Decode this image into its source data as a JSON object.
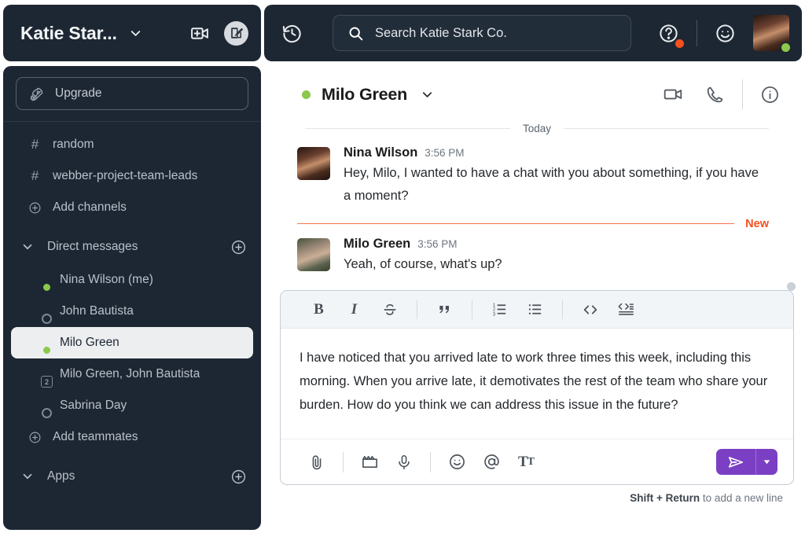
{
  "workspace": {
    "title": "Katie Star...",
    "chevron_icon": "chevron-down-icon",
    "new_call_icon": "new-video-call-icon",
    "compose_icon": "compose-message-icon"
  },
  "sidebar": {
    "upgrade": {
      "label": "Upgrade",
      "icon": "rocket-icon"
    },
    "channels": [
      {
        "label": "random",
        "icon": "hash-icon",
        "type": "channel"
      },
      {
        "label": "webber-project-team-leads",
        "icon": "hash-icon",
        "type": "channel"
      },
      {
        "label": "Add channels",
        "icon": "plus-circle-icon",
        "type": "action"
      }
    ],
    "dm_section": {
      "label": "Direct messages",
      "collapse_icon": "chevron-down-icon",
      "add_icon": "plus-circle-icon"
    },
    "dms": [
      {
        "label": "Nina Wilson (me)",
        "status": "online",
        "avatar": "nina",
        "active": false
      },
      {
        "label": "John Bautista",
        "status": "offline",
        "avatar": "john",
        "active": false
      },
      {
        "label": "Milo Green",
        "status": "online",
        "avatar": "milo",
        "active": true
      },
      {
        "label": "Milo Green, John Bautista",
        "status": "group",
        "badge": "2",
        "avatar": "milo",
        "active": false
      },
      {
        "label": "Sabrina Day",
        "status": "offline",
        "avatar": "sabrina",
        "active": false
      }
    ],
    "add_teammates": {
      "label": "Add teammates",
      "icon": "plus-circle-icon"
    },
    "apps_section": {
      "label": "Apps",
      "collapse_icon": "chevron-down-icon",
      "add_icon": "plus-circle-icon"
    }
  },
  "topbar": {
    "history_icon": "history-icon",
    "search": {
      "placeholder": "Search Katie Stark Co.",
      "icon": "search-icon"
    },
    "help_icon": "help-circle-icon",
    "help_badge": true,
    "emoji_icon": "smiley-icon",
    "avatar": "nina"
  },
  "conversation": {
    "name": "Milo Green",
    "presence": "online",
    "chevron_icon": "chevron-down-icon",
    "video_icon": "video-camera-icon",
    "call_icon": "phone-icon",
    "info_icon": "info-circle-icon",
    "day_label": "Today",
    "new_divider_label": "New",
    "messages": [
      {
        "author": "Nina Wilson",
        "time": "3:56 PM",
        "avatar": "nina",
        "text": "Hey, Milo, I wanted to have a chat with you about something, if you have a moment?"
      },
      {
        "author": "Milo Green",
        "time": "3:56 PM",
        "avatar": "milo",
        "text": "Yeah, of course, what's up?"
      }
    ]
  },
  "composer": {
    "format_buttons": [
      {
        "name": "bold-icon",
        "label": "B"
      },
      {
        "name": "italic-icon",
        "label": "I"
      },
      {
        "name": "strikethrough-icon",
        "label": "S"
      },
      {
        "name": "blockquote-icon",
        "label": "””"
      },
      {
        "name": "ordered-list-icon",
        "label": ""
      },
      {
        "name": "bulleted-list-icon",
        "label": ""
      },
      {
        "name": "inline-code-icon",
        "label": "<>"
      },
      {
        "name": "code-block-icon",
        "label": ""
      }
    ],
    "draft_text": "I have noticed that you arrived late to work three times this week, including this morning. When you arrive late, it demotivates the rest of the team who share your burden. How do you think we can address this issue in the future?",
    "action_buttons": [
      {
        "name": "attachment-icon"
      },
      {
        "name": "video-clip-icon"
      },
      {
        "name": "microphone-icon"
      },
      {
        "name": "emoji-icon"
      },
      {
        "name": "mention-icon"
      },
      {
        "name": "text-format-icon"
      }
    ],
    "send": {
      "icon": "send-icon",
      "caret_icon": "chevron-down-icon",
      "color": "#7b3fc4"
    },
    "hint_bold": "Shift + Return",
    "hint_rest": " to add a new line"
  },
  "colors": {
    "sidebar_bg": "#1d2733",
    "accent_orange": "#f4501e",
    "online_green": "#8cc84b",
    "send_purple": "#7b3fc4"
  }
}
